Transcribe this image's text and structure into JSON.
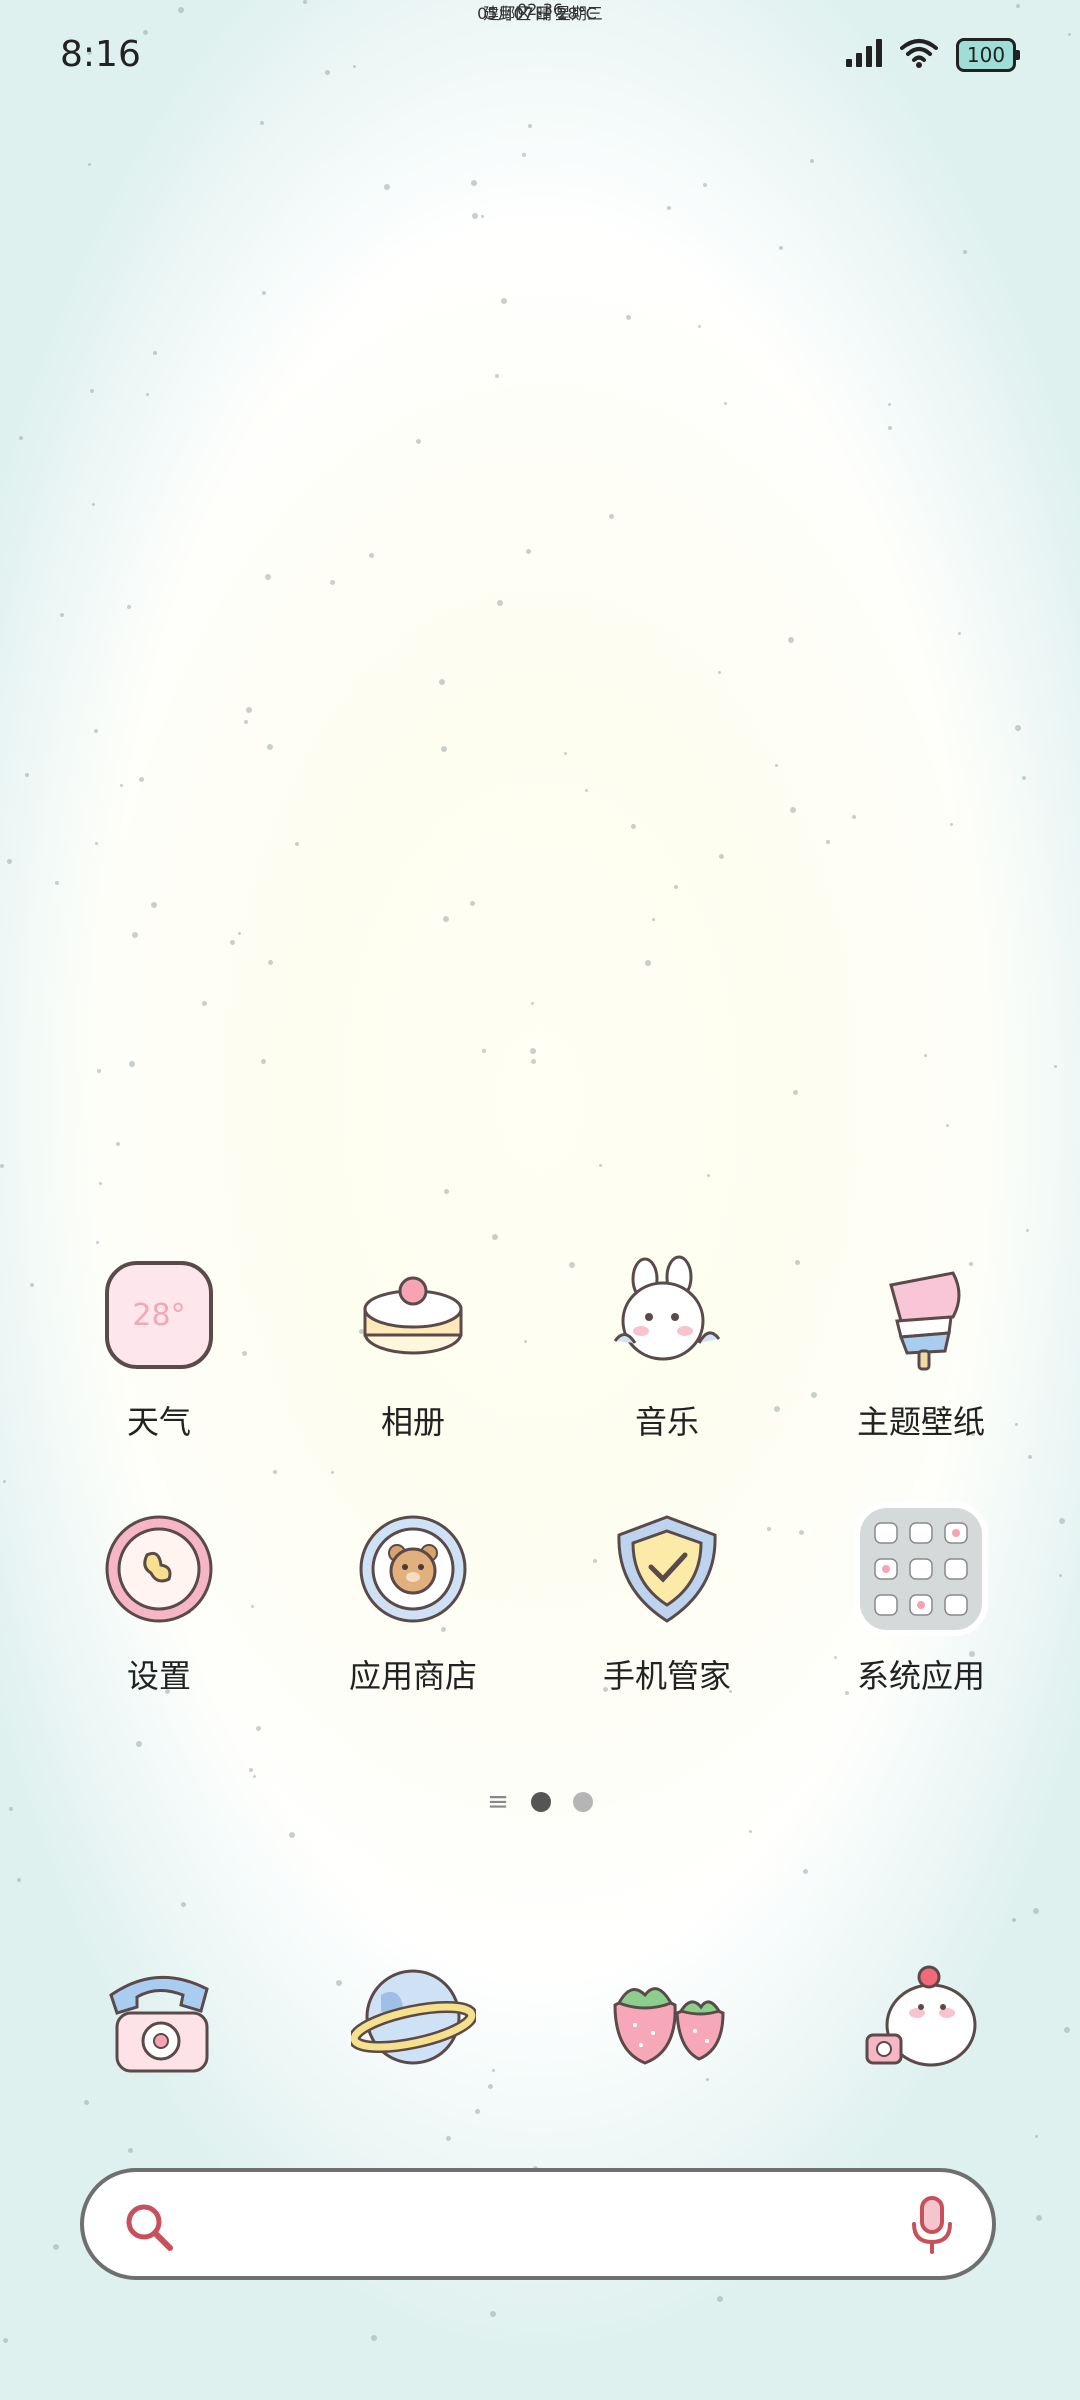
{
  "status_bar": {
    "time": "8:16",
    "battery": "100"
  },
  "clock": {
    "time": "02:36",
    "date": "05月07日 星期三",
    "weather": "建邺区 晴 28°C"
  },
  "apps": [
    {
      "label": "天气",
      "icon": "weather-icon",
      "badge": "28°"
    },
    {
      "label": "相册",
      "icon": "cake-icon"
    },
    {
      "label": "音乐",
      "icon": "bunny-music-icon"
    },
    {
      "label": "主题壁纸",
      "icon": "ice-cream-icon"
    },
    {
      "label": "设置",
      "icon": "settings-icon"
    },
    {
      "label": "应用商店",
      "icon": "bear-store-icon"
    },
    {
      "label": "手机管家",
      "icon": "shield-check-icon"
    },
    {
      "label": "系统应用",
      "icon": "folder-icon"
    }
  ],
  "page_indicator": {
    "pages": 2,
    "current": 1
  },
  "dock": [
    {
      "icon": "telephone-icon"
    },
    {
      "icon": "planet-browser-icon"
    },
    {
      "icon": "strawberry-messages-icon"
    },
    {
      "icon": "bunny-camera-icon"
    }
  ],
  "search": {
    "placeholder": ""
  },
  "colors": {
    "background": "#dff1ef",
    "accent_red": "#c8505a",
    "pink": "#f7c8d2"
  }
}
